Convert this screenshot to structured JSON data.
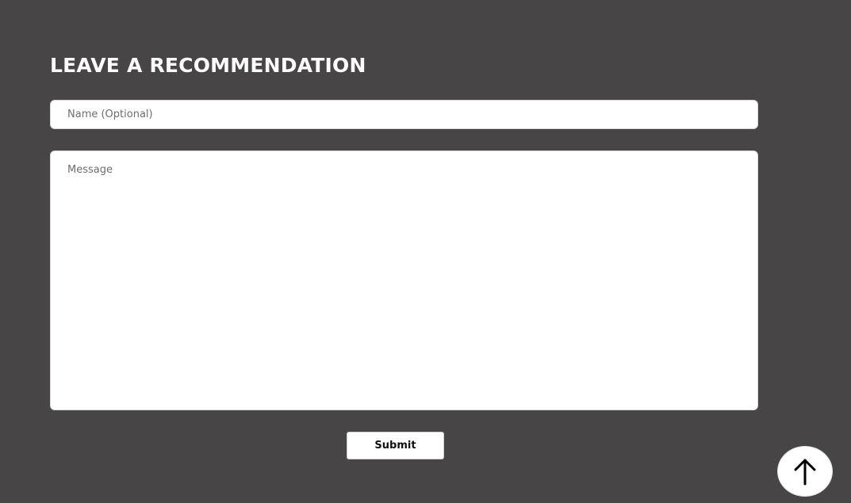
{
  "form": {
    "title": "LEAVE A RECOMMENDATION",
    "name_field": {
      "value": "",
      "placeholder": "Name (Optional)"
    },
    "message_field": {
      "value": "",
      "placeholder": "Message"
    },
    "submit_label": "Submit"
  },
  "scroll_top": {
    "icon": "arrow-up-icon"
  },
  "colors": {
    "background": "#484546",
    "field": "#ffffff",
    "title_text": "#ffffff"
  }
}
